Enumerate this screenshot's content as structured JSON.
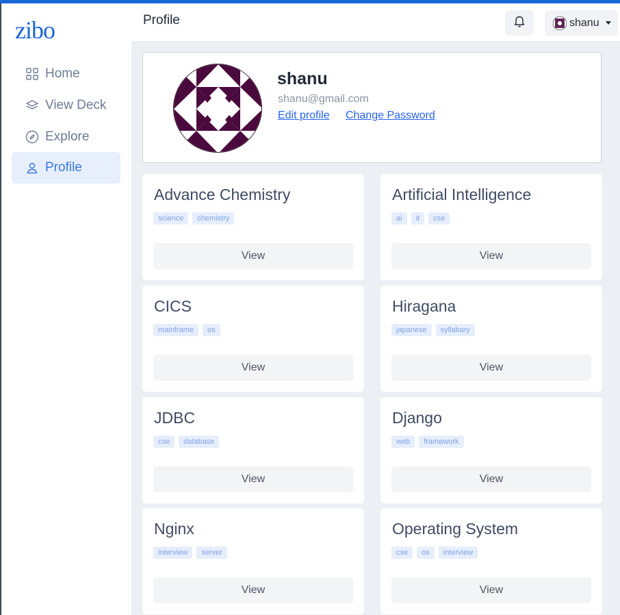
{
  "app": {
    "logo": "zibo",
    "accent": "#1a66d6"
  },
  "sidebar": {
    "items": [
      {
        "label": "Home",
        "icon": "grid-icon",
        "active": false
      },
      {
        "label": "View Deck",
        "icon": "layers-icon",
        "active": false
      },
      {
        "label": "Explore",
        "icon": "compass-icon",
        "active": false
      },
      {
        "label": "Profile",
        "icon": "user-icon",
        "active": true
      }
    ]
  },
  "header": {
    "title": "Profile",
    "bell_icon": "bell-icon",
    "user_menu": {
      "name": "shanu"
    }
  },
  "profile": {
    "name": "shanu",
    "email": "shanu@gmail.com",
    "edit_link": "Edit profile",
    "password_link": "Change Password",
    "avatar_color": "#4b0a3e"
  },
  "decks": [
    {
      "title": "Advance Chemistry",
      "tags": [
        "science",
        "chemistry"
      ],
      "button": "View"
    },
    {
      "title": "Artificial Intelligence",
      "tags": [
        "ai",
        "it",
        "cse"
      ],
      "button": "View"
    },
    {
      "title": "CICS",
      "tags": [
        "mainframe",
        "os"
      ],
      "button": "View"
    },
    {
      "title": "Hiragana",
      "tags": [
        "japanese",
        "syllabary"
      ],
      "button": "View"
    },
    {
      "title": "JDBC",
      "tags": [
        "cse",
        "database"
      ],
      "button": "View"
    },
    {
      "title": "Django",
      "tags": [
        "web",
        "framework"
      ],
      "button": "View"
    },
    {
      "title": "Nginx",
      "tags": [
        "interview",
        "server"
      ],
      "button": "View"
    },
    {
      "title": "Operating System",
      "tags": [
        "cse",
        "os",
        "interview"
      ],
      "button": "View"
    }
  ]
}
